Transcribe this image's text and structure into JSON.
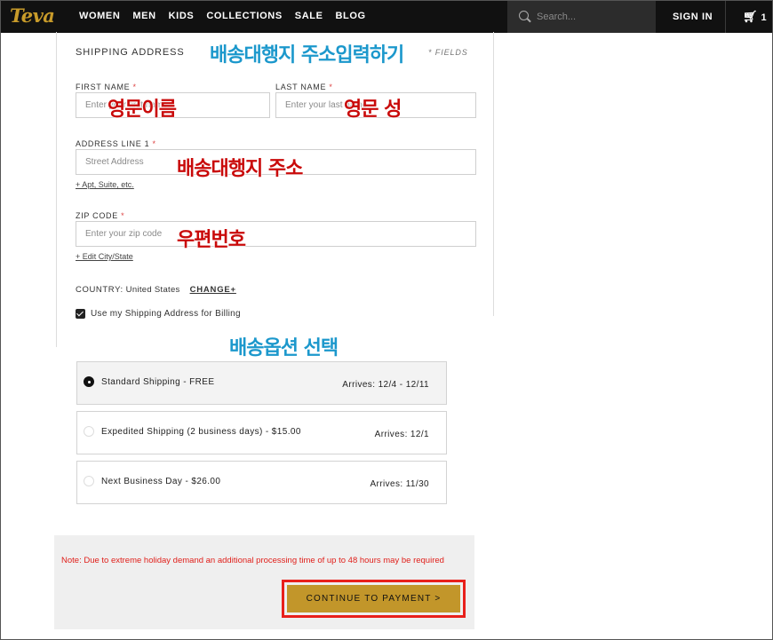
{
  "nav": {
    "logo": "Teva",
    "items": [
      "WOMEN",
      "MEN",
      "KIDS",
      "COLLECTIONS",
      "SALE",
      "BLOG"
    ],
    "search_placeholder": "Search...",
    "sign_in": "SIGN IN",
    "cart_count": "1"
  },
  "form": {
    "section_title": "SHIPPING ADDRESS",
    "required_note": "* FIELDS",
    "first_name": {
      "label": "FIRST NAME",
      "placeholder": "Enter your first name"
    },
    "last_name": {
      "label": "LAST NAME",
      "placeholder": "Enter your last name"
    },
    "address1": {
      "label": "ADDRESS LINE 1",
      "placeholder": "Street Address"
    },
    "apt_link": "+ Apt, Suite, etc.",
    "zip": {
      "label": "ZIP CODE",
      "placeholder": "Enter your zip code"
    },
    "edit_city_link": "+ Edit City/State",
    "country_label": "COUNTRY:",
    "country_value": "United States",
    "change_link": "CHANGE+",
    "billing_label": "Use my Shipping Address for Billing",
    "billing_checked": true
  },
  "shipping_options": [
    {
      "name": "Standard Shipping - FREE",
      "arrives": "Arrives: 12/4 - 12/11",
      "selected": true
    },
    {
      "name": "Expedited Shipping (2 business days) - $15.00",
      "arrives": "Arrives: 12/1",
      "selected": false
    },
    {
      "name": "Next Business Day - $26.00",
      "arrives": "Arrives: 11/30",
      "selected": false
    }
  ],
  "note": "Note: Due to extreme holiday demand an additional processing time of up to 48 hours may be required",
  "continue_label": "CONTINUE TO PAYMENT >",
  "annotations": {
    "title": "배송대행지 주소입력하기",
    "first_name": "영문이름",
    "last_name": "영문 성",
    "address": "배송대행지 주소",
    "zip": "우편번호",
    "shipping": "배송옵션 선택"
  },
  "colors": {
    "nav_bg": "#111111",
    "logo": "#c89b2a",
    "button": "#c2962a",
    "highlight": "#e8201b",
    "annotation_red": "#c90a0a",
    "annotation_blue": "#1c98cc"
  }
}
